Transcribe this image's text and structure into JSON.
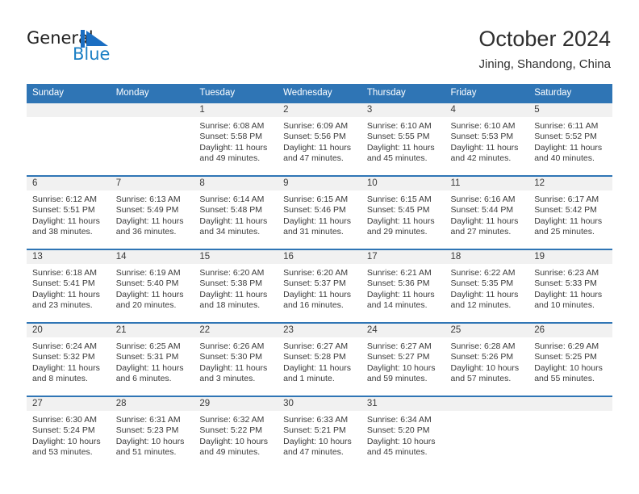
{
  "brand": {
    "name_part1": "General",
    "name_part2": "Blue",
    "accent_color": "#1b7fc4",
    "header_color": "#2f75b5"
  },
  "header": {
    "title": "October 2024",
    "subtitle": "Jining, Shandong, China"
  },
  "calendar": {
    "weekday_headers": [
      "Sunday",
      "Monday",
      "Tuesday",
      "Wednesday",
      "Thursday",
      "Friday",
      "Saturday"
    ],
    "weeks": [
      [
        {
          "day": "",
          "sunrise": "",
          "sunset": "",
          "daylight_line1": "",
          "daylight_line2": ""
        },
        {
          "day": "",
          "sunrise": "",
          "sunset": "",
          "daylight_line1": "",
          "daylight_line2": ""
        },
        {
          "day": "1",
          "sunrise": "Sunrise: 6:08 AM",
          "sunset": "Sunset: 5:58 PM",
          "daylight_line1": "Daylight: 11 hours",
          "daylight_line2": "and 49 minutes."
        },
        {
          "day": "2",
          "sunrise": "Sunrise: 6:09 AM",
          "sunset": "Sunset: 5:56 PM",
          "daylight_line1": "Daylight: 11 hours",
          "daylight_line2": "and 47 minutes."
        },
        {
          "day": "3",
          "sunrise": "Sunrise: 6:10 AM",
          "sunset": "Sunset: 5:55 PM",
          "daylight_line1": "Daylight: 11 hours",
          "daylight_line2": "and 45 minutes."
        },
        {
          "day": "4",
          "sunrise": "Sunrise: 6:10 AM",
          "sunset": "Sunset: 5:53 PM",
          "daylight_line1": "Daylight: 11 hours",
          "daylight_line2": "and 42 minutes."
        },
        {
          "day": "5",
          "sunrise": "Sunrise: 6:11 AM",
          "sunset": "Sunset: 5:52 PM",
          "daylight_line1": "Daylight: 11 hours",
          "daylight_line2": "and 40 minutes."
        }
      ],
      [
        {
          "day": "6",
          "sunrise": "Sunrise: 6:12 AM",
          "sunset": "Sunset: 5:51 PM",
          "daylight_line1": "Daylight: 11 hours",
          "daylight_line2": "and 38 minutes."
        },
        {
          "day": "7",
          "sunrise": "Sunrise: 6:13 AM",
          "sunset": "Sunset: 5:49 PM",
          "daylight_line1": "Daylight: 11 hours",
          "daylight_line2": "and 36 minutes."
        },
        {
          "day": "8",
          "sunrise": "Sunrise: 6:14 AM",
          "sunset": "Sunset: 5:48 PM",
          "daylight_line1": "Daylight: 11 hours",
          "daylight_line2": "and 34 minutes."
        },
        {
          "day": "9",
          "sunrise": "Sunrise: 6:15 AM",
          "sunset": "Sunset: 5:46 PM",
          "daylight_line1": "Daylight: 11 hours",
          "daylight_line2": "and 31 minutes."
        },
        {
          "day": "10",
          "sunrise": "Sunrise: 6:15 AM",
          "sunset": "Sunset: 5:45 PM",
          "daylight_line1": "Daylight: 11 hours",
          "daylight_line2": "and 29 minutes."
        },
        {
          "day": "11",
          "sunrise": "Sunrise: 6:16 AM",
          "sunset": "Sunset: 5:44 PM",
          "daylight_line1": "Daylight: 11 hours",
          "daylight_line2": "and 27 minutes."
        },
        {
          "day": "12",
          "sunrise": "Sunrise: 6:17 AM",
          "sunset": "Sunset: 5:42 PM",
          "daylight_line1": "Daylight: 11 hours",
          "daylight_line2": "and 25 minutes."
        }
      ],
      [
        {
          "day": "13",
          "sunrise": "Sunrise: 6:18 AM",
          "sunset": "Sunset: 5:41 PM",
          "daylight_line1": "Daylight: 11 hours",
          "daylight_line2": "and 23 minutes."
        },
        {
          "day": "14",
          "sunrise": "Sunrise: 6:19 AM",
          "sunset": "Sunset: 5:40 PM",
          "daylight_line1": "Daylight: 11 hours",
          "daylight_line2": "and 20 minutes."
        },
        {
          "day": "15",
          "sunrise": "Sunrise: 6:20 AM",
          "sunset": "Sunset: 5:38 PM",
          "daylight_line1": "Daylight: 11 hours",
          "daylight_line2": "and 18 minutes."
        },
        {
          "day": "16",
          "sunrise": "Sunrise: 6:20 AM",
          "sunset": "Sunset: 5:37 PM",
          "daylight_line1": "Daylight: 11 hours",
          "daylight_line2": "and 16 minutes."
        },
        {
          "day": "17",
          "sunrise": "Sunrise: 6:21 AM",
          "sunset": "Sunset: 5:36 PM",
          "daylight_line1": "Daylight: 11 hours",
          "daylight_line2": "and 14 minutes."
        },
        {
          "day": "18",
          "sunrise": "Sunrise: 6:22 AM",
          "sunset": "Sunset: 5:35 PM",
          "daylight_line1": "Daylight: 11 hours",
          "daylight_line2": "and 12 minutes."
        },
        {
          "day": "19",
          "sunrise": "Sunrise: 6:23 AM",
          "sunset": "Sunset: 5:33 PM",
          "daylight_line1": "Daylight: 11 hours",
          "daylight_line2": "and 10 minutes."
        }
      ],
      [
        {
          "day": "20",
          "sunrise": "Sunrise: 6:24 AM",
          "sunset": "Sunset: 5:32 PM",
          "daylight_line1": "Daylight: 11 hours",
          "daylight_line2": "and 8 minutes."
        },
        {
          "day": "21",
          "sunrise": "Sunrise: 6:25 AM",
          "sunset": "Sunset: 5:31 PM",
          "daylight_line1": "Daylight: 11 hours",
          "daylight_line2": "and 6 minutes."
        },
        {
          "day": "22",
          "sunrise": "Sunrise: 6:26 AM",
          "sunset": "Sunset: 5:30 PM",
          "daylight_line1": "Daylight: 11 hours",
          "daylight_line2": "and 3 minutes."
        },
        {
          "day": "23",
          "sunrise": "Sunrise: 6:27 AM",
          "sunset": "Sunset: 5:28 PM",
          "daylight_line1": "Daylight: 11 hours",
          "daylight_line2": "and 1 minute."
        },
        {
          "day": "24",
          "sunrise": "Sunrise: 6:27 AM",
          "sunset": "Sunset: 5:27 PM",
          "daylight_line1": "Daylight: 10 hours",
          "daylight_line2": "and 59 minutes."
        },
        {
          "day": "25",
          "sunrise": "Sunrise: 6:28 AM",
          "sunset": "Sunset: 5:26 PM",
          "daylight_line1": "Daylight: 10 hours",
          "daylight_line2": "and 57 minutes."
        },
        {
          "day": "26",
          "sunrise": "Sunrise: 6:29 AM",
          "sunset": "Sunset: 5:25 PM",
          "daylight_line1": "Daylight: 10 hours",
          "daylight_line2": "and 55 minutes."
        }
      ],
      [
        {
          "day": "27",
          "sunrise": "Sunrise: 6:30 AM",
          "sunset": "Sunset: 5:24 PM",
          "daylight_line1": "Daylight: 10 hours",
          "daylight_line2": "and 53 minutes."
        },
        {
          "day": "28",
          "sunrise": "Sunrise: 6:31 AM",
          "sunset": "Sunset: 5:23 PM",
          "daylight_line1": "Daylight: 10 hours",
          "daylight_line2": "and 51 minutes."
        },
        {
          "day": "29",
          "sunrise": "Sunrise: 6:32 AM",
          "sunset": "Sunset: 5:22 PM",
          "daylight_line1": "Daylight: 10 hours",
          "daylight_line2": "and 49 minutes."
        },
        {
          "day": "30",
          "sunrise": "Sunrise: 6:33 AM",
          "sunset": "Sunset: 5:21 PM",
          "daylight_line1": "Daylight: 10 hours",
          "daylight_line2": "and 47 minutes."
        },
        {
          "day": "31",
          "sunrise": "Sunrise: 6:34 AM",
          "sunset": "Sunset: 5:20 PM",
          "daylight_line1": "Daylight: 10 hours",
          "daylight_line2": "and 45 minutes."
        },
        {
          "day": "",
          "sunrise": "",
          "sunset": "",
          "daylight_line1": "",
          "daylight_line2": ""
        },
        {
          "day": "",
          "sunrise": "",
          "sunset": "",
          "daylight_line1": "",
          "daylight_line2": ""
        }
      ]
    ]
  }
}
